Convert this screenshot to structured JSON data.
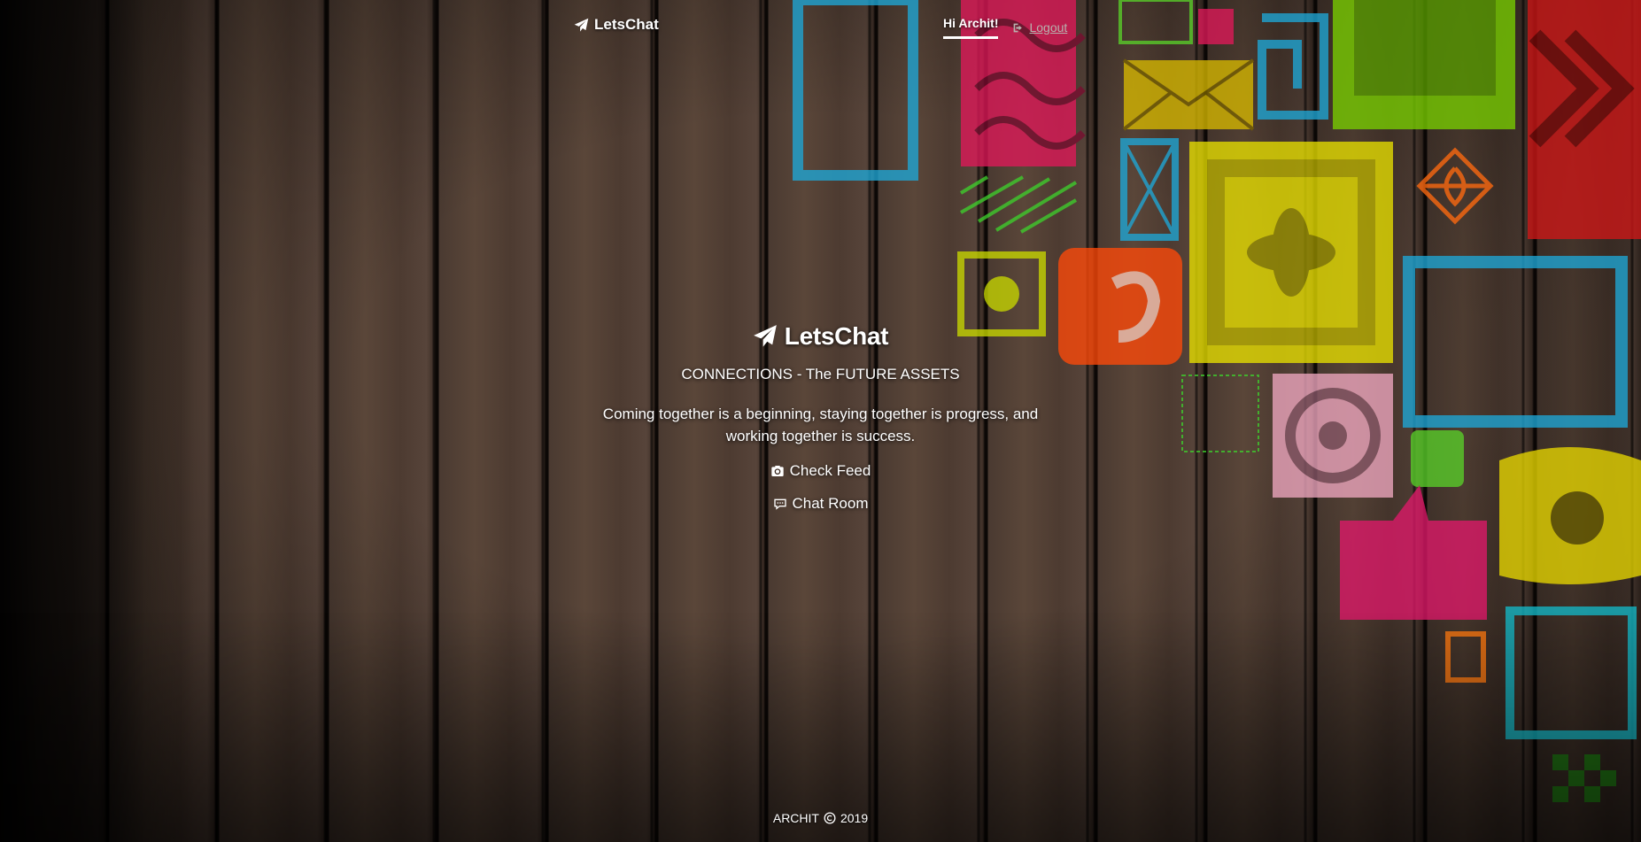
{
  "navbar": {
    "brand": "LetsChat",
    "greeting": "Hi Archit!",
    "logout": "Logout"
  },
  "hero": {
    "title": "LetsChat",
    "tagline": "CONNECTIONS - The FUTURE ASSETS",
    "lead": "Coming together is a beginning, staying together is progress, and working together is success.",
    "links": {
      "feed": "Check Feed",
      "chat": "Chat Room"
    }
  },
  "footer": {
    "name": "ARCHIT",
    "year": "2019"
  },
  "icons": {
    "brand": "paper-plane-icon",
    "logout": "sign-out-icon",
    "feed": "camera-icon",
    "chat": "speech-bubble-icon",
    "copyright": "copyright-icon"
  },
  "colors": {
    "wood": "#4a3a31",
    "text": "#ffffff",
    "muted": "#b8b2ae",
    "art_pink": "#e0195a",
    "art_yellow": "#e8e000",
    "art_blue": "#1ea8d8",
    "art_orange": "#ff5a10",
    "art_green": "#5ad02a"
  }
}
